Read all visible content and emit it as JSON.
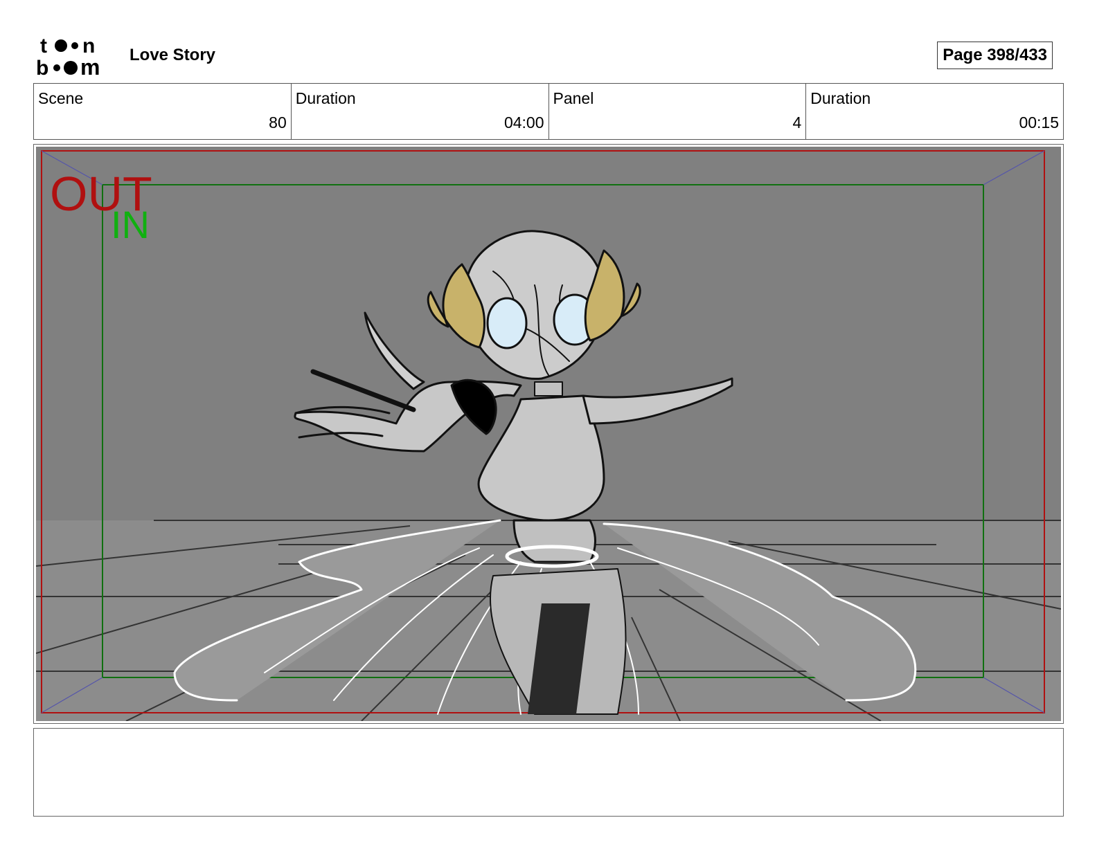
{
  "header": {
    "logo_text": "toon boom",
    "project_title": "Love Story",
    "page_label": "Page 398/433"
  },
  "info": {
    "scene_label": "Scene",
    "scene_value": "80",
    "scene_duration_label": "Duration",
    "scene_duration_value": "04:00",
    "panel_label": "Panel",
    "panel_value": "4",
    "panel_duration_label": "Duration",
    "panel_duration_value": "00:15"
  },
  "panel_frame": {
    "out_label": "OUT",
    "in_label": "IN",
    "out_color": "#b01010",
    "in_color": "#10b010",
    "background": "#808080"
  },
  "notes": {
    "text": ""
  }
}
